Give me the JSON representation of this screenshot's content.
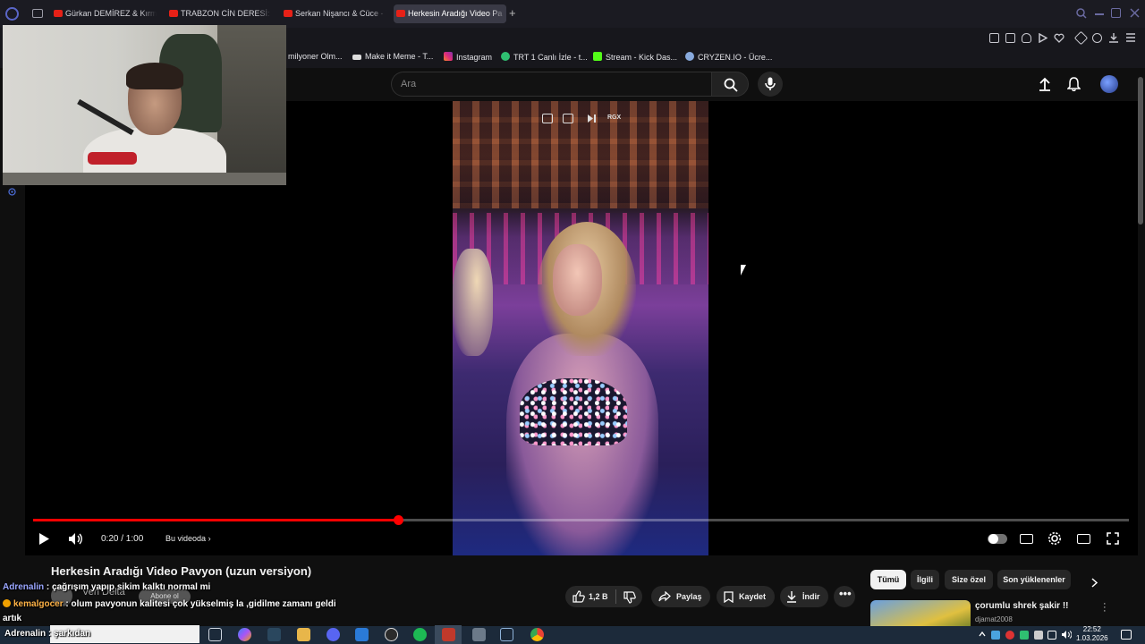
{
  "browser": {
    "tabs": [
      {
        "label": "Gürkan DEMİREZ & Kırmızı"
      },
      {
        "label": "TRABZON CİN DERESİ: Vİ"
      },
      {
        "label": "Serkan Nişancı & Cüce - T"
      },
      {
        "label": "Herkesin Aradığı Video Pa",
        "active": true
      }
    ],
    "new_tab": "+",
    "bookmarks": [
      {
        "label": "milyoner Olm...",
        "icon": "bookmark-icon"
      },
      {
        "label": "Make it Meme - T...",
        "icon": "meme-icon"
      },
      {
        "label": "Instagram",
        "icon": "instagram-icon"
      },
      {
        "label": "TRT 1 Canlı İzle - t...",
        "icon": "trt-icon"
      },
      {
        "label": "Stream - Kick Das...",
        "icon": "kick-icon"
      },
      {
        "label": "CRYZEN.IO - Ücre...",
        "icon": "cryzen-icon"
      }
    ]
  },
  "youtube": {
    "search_placeholder": "Ara",
    "player": {
      "overlay_label": "RGX",
      "time": "0:20 / 1:00",
      "chapters": "Bu videoda",
      "progress": 0.333
    },
    "video": {
      "title": "Herkesin Aradığı Video Pavyon (uzun versiyon)",
      "channel": "Veri Delta",
      "subscribe": "Abone ol",
      "likes": "1,2 B",
      "share": "Paylaş",
      "save": "Kaydet",
      "download": "İndir"
    },
    "chips": [
      "Tümü",
      "İlgili",
      "Size özel",
      "Son yüklenenler"
    ],
    "recommendation": {
      "title": "çorumlu shrek şakir !!",
      "channel": "djamat2008"
    }
  },
  "stream_chat": [
    {
      "user": "Adrenalin",
      "sep": " : ",
      "text": "çağrışım yapıp sikim kalktı normal mi"
    },
    {
      "user": "kemalgocer",
      "sep": " : ",
      "text": "olum pavyonun kalitesi çok yükselmiş la ,gidilme zamanı geldi"
    },
    {
      "user": "",
      "sep": "",
      "text": "artık"
    },
    {
      "user": "Adrenalin",
      "sep": " : ",
      "text": "şarkıdan"
    }
  ],
  "taskbar": {
    "time": "22:52",
    "date": "1.03.2026"
  },
  "colors": {
    "accent_red": "#ff0000",
    "background": "#0f0f0f",
    "taskbar": "#1c2a3a"
  }
}
